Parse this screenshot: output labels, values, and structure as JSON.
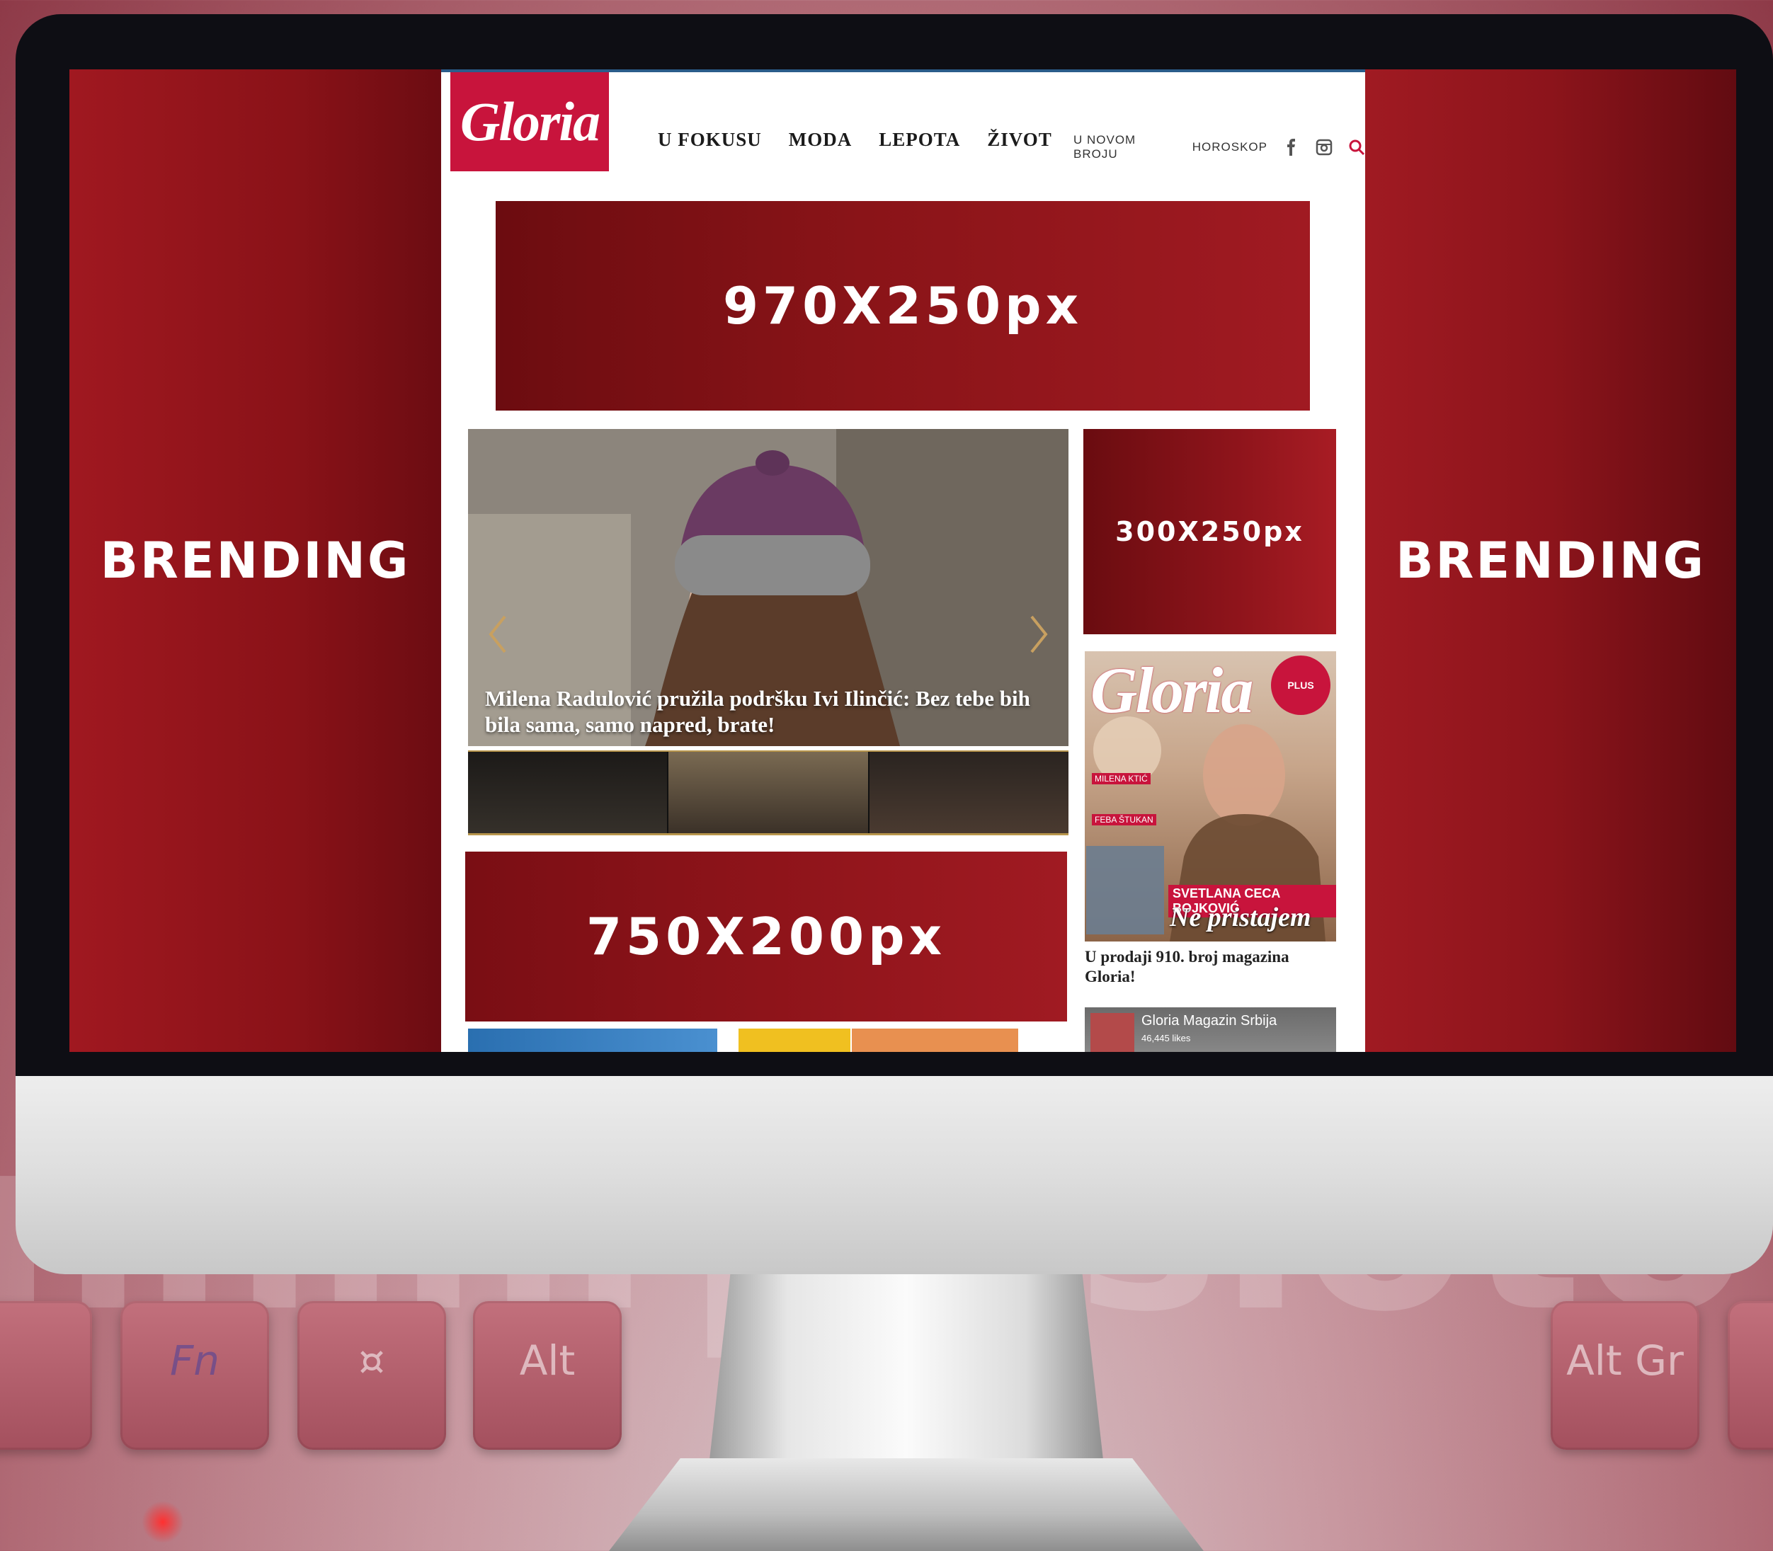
{
  "background": {
    "keys": [
      "Fn",
      "¤",
      "Alt",
      "Alt Gr"
    ]
  },
  "colors": {
    "brand_red": "#c8143c",
    "ad_red": "#8a1218",
    "bezel": "#0e0e14"
  },
  "branding": {
    "left": "BRENDING",
    "right": "BRENDING"
  },
  "ads": {
    "leaderboard": "970X250px",
    "rectangle": "300X250px",
    "inline": "750X200px"
  },
  "site": {
    "logo": "Gloria",
    "nav": [
      "U FOKUSU",
      "MODA",
      "LEPOTA",
      "ŽIVOT"
    ],
    "subnav": [
      "U NOVOM BROJU",
      "HOROSKOP"
    ],
    "icons": [
      "facebook-icon",
      "instagram-icon",
      "search-icon"
    ]
  },
  "hero": {
    "headline": "Milena Radulović pružila podršku Ivi Ilinčić: Bez tebe bih bila sama, samo napred, brate!"
  },
  "sidebar": {
    "cover": {
      "logo": "Gloria",
      "plus_badge": "PLUS",
      "name_tag": "MILENA KTIĆ",
      "feba_tag": "FEBA ŠTUKAN",
      "headline_name": "SVETLANA CECA BOJKOVIĆ",
      "headline_text": "Ne pristajem"
    },
    "cover_caption": "U prodaji 910. broj magazina Gloria!",
    "facebook_box": {
      "title": "Gloria Magazin Srbija",
      "likes": "46,445 likes"
    }
  }
}
